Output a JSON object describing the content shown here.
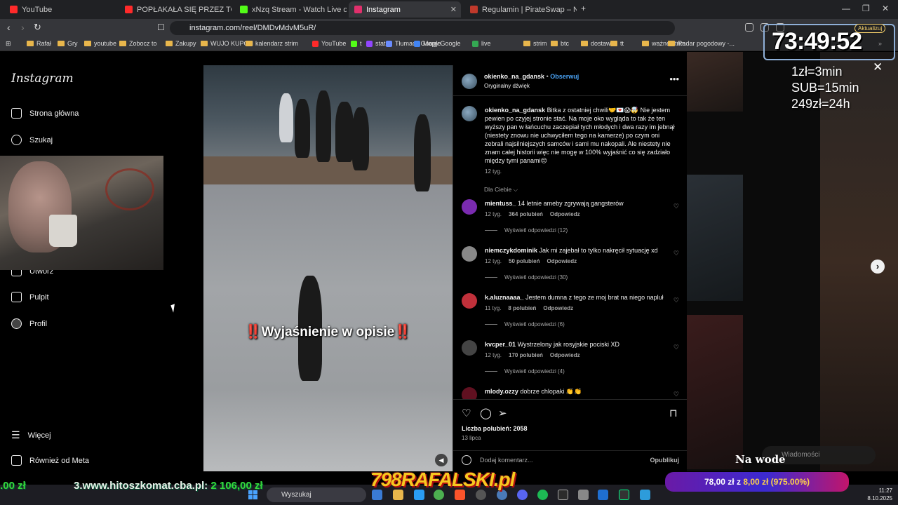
{
  "browser": {
    "tabs": [
      {
        "label": "YouTube",
        "color": "#ff2a2a"
      },
      {
        "label": "POPŁAKAŁA SIĘ PRZEZ TO! BUNGEE",
        "color": "#ff2a2a"
      },
      {
        "label": "xNzq Stream - Watch Live on Kick",
        "color": "#53fc18"
      },
      {
        "label": "Instagram",
        "color": "#e1306c"
      },
      {
        "label": "Regulamin | PirateSwap – Najlepsza",
        "color": "#c0392b"
      }
    ],
    "url": "instagram.com/reel/DMDvMdvM5uR/",
    "update_label": "Aktualizuj",
    "bookmarks": [
      "Rafał",
      "Gry",
      "youtube",
      "Zobocz to",
      "Zakupy",
      "WUJO KUPON",
      "kalendarz strim",
      "YouTube",
      "t",
      "stats",
      "Tłumacz Google",
      "Mapy Google",
      "live",
      "strim",
      "btc",
      "dostawa",
      "tt",
      "ważne strim",
      "Radar pogodowy -..."
    ]
  },
  "sidebar": {
    "logo": "Instagram",
    "items": [
      {
        "label": "Strona główna",
        "icon": "home-icon"
      },
      {
        "label": "Szukaj",
        "icon": "search-icon"
      },
      {
        "label": "Utwórz",
        "icon": "create-icon"
      },
      {
        "label": "Pulpit",
        "icon": "dashboard-icon"
      },
      {
        "label": "Profil",
        "icon": "profile-icon"
      }
    ],
    "more": "Więcej",
    "meta": "Również od Meta"
  },
  "video": {
    "overlay_text": "‼️Wyjaśnienie w opisie‼️"
  },
  "post": {
    "author": "okienko_na_gdansk",
    "follow": "Obserwuj",
    "audio": "Oryginalny dźwięk",
    "caption": "Bitka z ostatniej chwili🤝💌😱🤯 Nie jestem pewien po czyjej stronie stać. Na moje oko wygląda to tak że ten wyższy pan w łańcuchu zaczepiał tych młodych i dwa razy im jebnął (niestety znowu nie uchwyciłem tego na kamerze) po czym oni zebrali najsilniejszych samców i sami mu nakopali. Ale niestety nie znam całej historii więc nie mogę w 100% wyjaśnić co się zadziało między tymi panami😔",
    "caption_time": "12 tyg.",
    "filter": "Dla Ciebie",
    "comments": [
      {
        "user": "mientuss_",
        "text": "14 letnie ameby zgrywają gangsterów",
        "time": "12 tyg.",
        "likes": "364 polubień",
        "reply": "Odpowiedz",
        "replies": "Wyświetl odpowiedzi (12)"
      },
      {
        "user": "niemczykdominik",
        "text": "Jak mi zajebał to tylko nakręcił sytuację xd",
        "time": "12 tyg.",
        "likes": "50 polubień",
        "reply": "Odpowiedz",
        "replies": "Wyświetl odpowiedzi (30)"
      },
      {
        "user": "k.aluznaaaa_",
        "text": "Jestem dumna z tego ze moj brat na niego napluł",
        "time": "11 tyg.",
        "likes": "8 polubień",
        "reply": "Odpowiedz",
        "replies": "Wyświetl odpowiedzi (6)"
      },
      {
        "user": "kvcper_01",
        "text": "Wystrzelony jak rosyjskie pociski XD",
        "time": "12 tyg.",
        "likes": "170 polubień",
        "reply": "Odpowiedz",
        "replies": "Wyświetl odpowiedzi (4)"
      },
      {
        "user": "mlody.ozzy",
        "text": "dobrze chlopaki 👏👏",
        "time": "",
        "likes": "",
        "reply": "",
        "replies": ""
      }
    ],
    "likes_label": "Liczba polubień: 2058",
    "date": "13 lipca",
    "comment_placeholder": "Dodaj komentarz...",
    "publish": "Opublikuj"
  },
  "stream": {
    "timer": "73:49:52",
    "prices": [
      "1zł=3min",
      "SUB=15min",
      "249zł=24h"
    ],
    "brand": "798RAFALSKI.pl",
    "ticker_left": ".00 zł",
    "ticker_mid": "3.www.hitoszkomat.cba.pl:",
    "ticker_right": "2 106,00 zł",
    "donation_a": "78,00 zł z ",
    "donation_b": "8,00 zł",
    "donation_c": " (975.00%)",
    "na_wode": "Na wode",
    "messages": "Wiadomości"
  },
  "taskbar": {
    "search": "Wyszukaj",
    "time": "11:27",
    "date": "8.10.2025"
  }
}
